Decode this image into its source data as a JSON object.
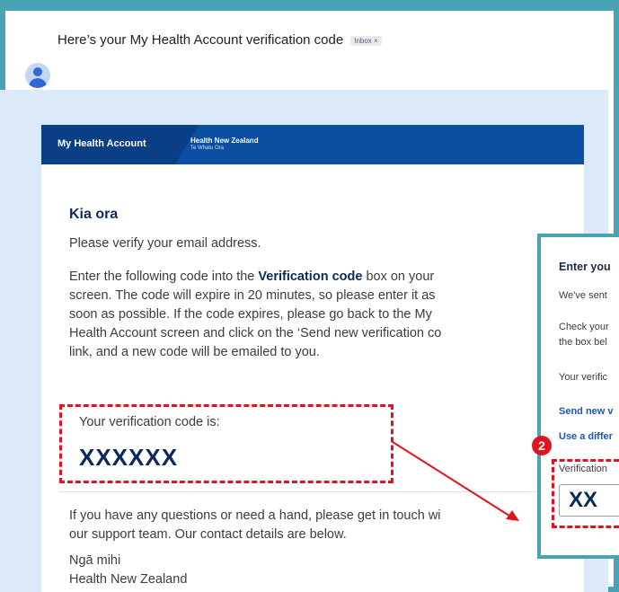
{
  "email": {
    "subject": "Here’s your My Health Account verification code",
    "inbox_label": "Inbox ×",
    "brand": {
      "app_name": "My Health Account",
      "org_name": "Health New Zealand",
      "org_maori": "Te Whatu Ora"
    },
    "greeting": "Kia ora",
    "verify_text": "Please verify your email address.",
    "instructions": {
      "line1_pre": "Enter the following code into the ",
      "line1_bold": "Verification code",
      "line1_post": " box on your",
      "line2": "screen. The code will expire in 20 minutes, so please enter it as",
      "line3": "soon as possible. If the code expires, please go back to the My",
      "line4": "Health Account screen and click on the ‘Send new verification co",
      "line5": "link, and a new code will be emailed to you."
    },
    "code_label": "Your verification code is:",
    "code_value": "XXXXXX",
    "support": {
      "line1": "If you have any questions or need a hand, please get in touch wi",
      "line2": "our support team. Our contact details are below."
    },
    "signoff": {
      "line1": "Ngā mihi",
      "line2": "Health New Zealand"
    }
  },
  "popup": {
    "title": "Enter you",
    "sent_text": "We've sent",
    "check_line1": "Check your",
    "check_line2": "the box bel",
    "verific_text": "Your verific",
    "send_new_link": "Send new v",
    "use_diff_link": "Use a differ",
    "verification_label": "Verification",
    "input_value": "XX"
  },
  "annotation": {
    "step_number": "2",
    "highlight_color": "#e0141e"
  }
}
